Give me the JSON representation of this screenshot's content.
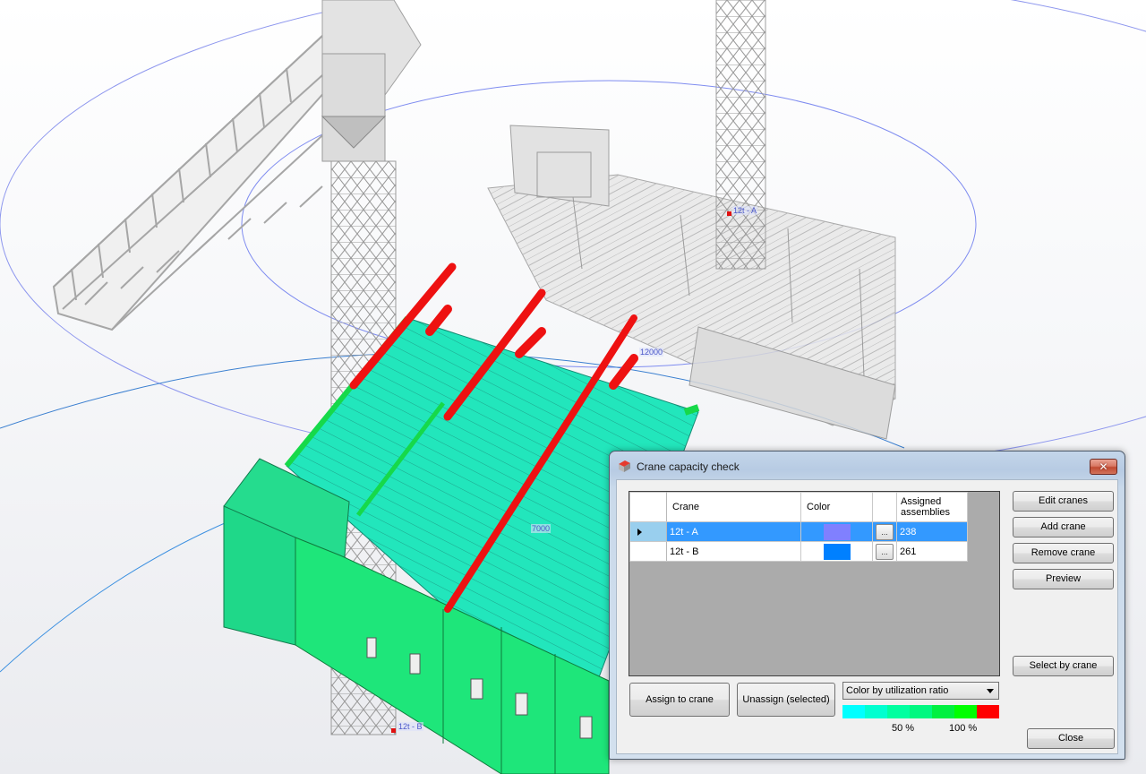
{
  "scene": {
    "labels": {
      "crane_a": "12t - A",
      "crane_b": "12t - B",
      "radius_outer": "12000",
      "radius_inner": "7000"
    }
  },
  "dialog": {
    "title": "Crane capacity check",
    "close_glyph": "✕",
    "grid": {
      "columns": [
        "",
        "Crane",
        "Color",
        "",
        "Assigned assemblies"
      ],
      "rows": [
        {
          "crane": "12t - A",
          "color": "#8080ff",
          "button": "...",
          "assigned": "238",
          "selected": true
        },
        {
          "crane": "12t - B",
          "color": "#0080ff",
          "button": "...",
          "assigned": "261",
          "selected": false
        }
      ]
    },
    "buttons": {
      "edit_cranes": "Edit cranes",
      "add_crane": "Add crane",
      "remove_crane": "Remove crane",
      "preview": "Preview",
      "select_by_crane": "Select by crane",
      "assign_to_crane": "Assign to crane",
      "unassign_selected": "Unassign (selected)",
      "close": "Close"
    },
    "color_mode": {
      "selected": "Color by utilization ratio"
    },
    "utilization_scale": {
      "colors": [
        "#00ffff",
        "#00ffd0",
        "#00ffa0",
        "#00f880",
        "#00f040",
        "#00ff00",
        "#ff0000"
      ],
      "label_50": "50 %",
      "label_100": "100 %"
    }
  }
}
